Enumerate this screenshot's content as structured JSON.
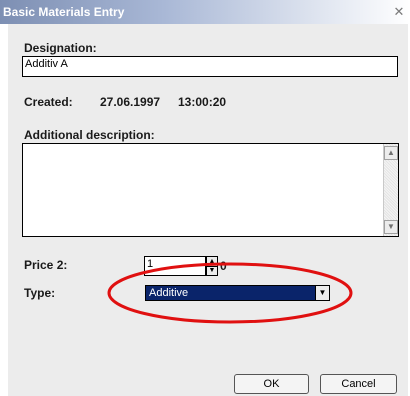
{
  "window": {
    "title": "Basic Materials Entry",
    "close_glyph": "✕"
  },
  "designation": {
    "label": "Designation:",
    "value": "Additiv A"
  },
  "created": {
    "label": "Created:",
    "date": "27.06.1997",
    "time": "13:00:20"
  },
  "additional_description": {
    "label": "Additional description:",
    "value": ""
  },
  "price2": {
    "label": "Price 2:",
    "value": "1",
    "suffix": "0"
  },
  "type": {
    "label": "Type:",
    "selected": "Additive"
  },
  "buttons": {
    "ok": "OK",
    "cancel": "Cancel"
  },
  "annotation": {
    "color": "#e01010"
  },
  "colors": {
    "title_gradient_start": "#7d8fb3",
    "dialog_bg": "#ececec",
    "select_highlight": "#0a246a"
  }
}
